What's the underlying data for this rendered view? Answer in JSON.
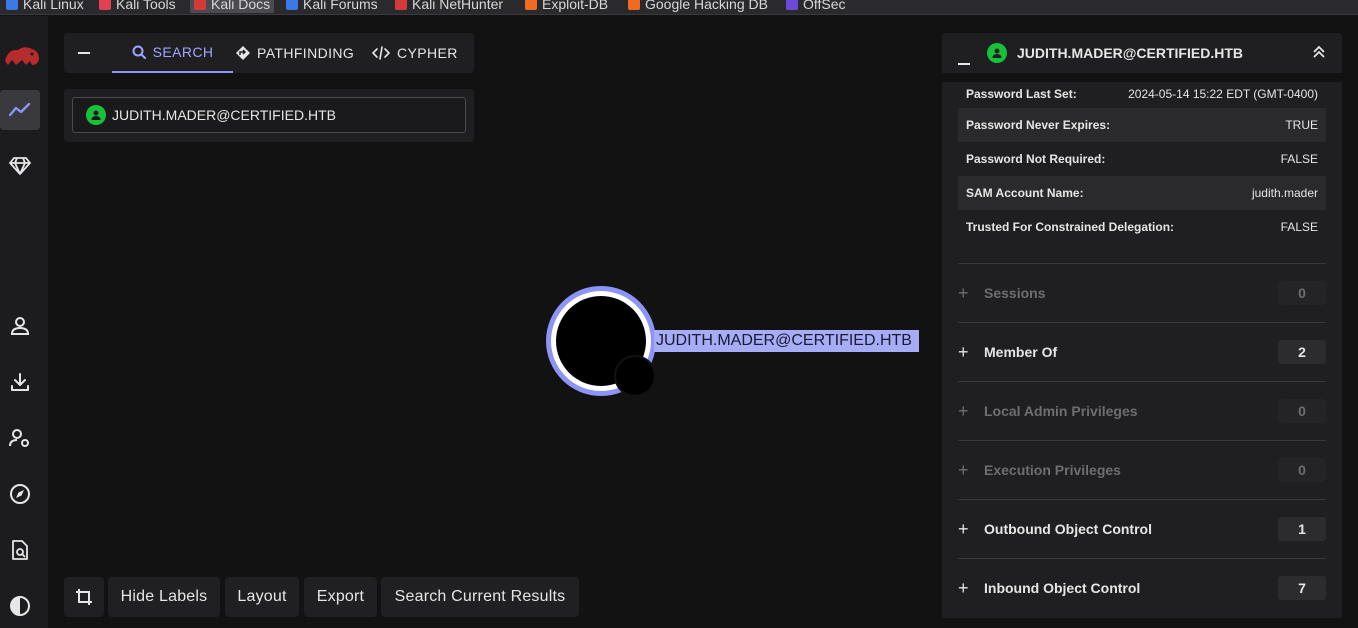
{
  "bookmarks": [
    {
      "label": "Kali Linux",
      "color": "#3b78e7"
    },
    {
      "label": "Kali Tools",
      "color": "#e0404f"
    },
    {
      "label": "Kali Docs",
      "color": "#d53a3a"
    },
    {
      "label": "Kali Forums",
      "color": "#3b78e7"
    },
    {
      "label": "Kali NetHunter",
      "color": "#d53a3a"
    },
    {
      "label": "Exploit-DB",
      "color": "#f06a22"
    },
    {
      "label": "Google Hacking DB",
      "color": "#f06a22"
    },
    {
      "label": "OffSec",
      "color": "#6a4bd8"
    }
  ],
  "search_panel": {
    "tabs": [
      {
        "label": "SEARCH",
        "icon": "search-icon"
      },
      {
        "label": "PATHFINDING",
        "icon": "diamond-arrow-icon"
      },
      {
        "label": "CYPHER",
        "icon": "code-icon"
      }
    ],
    "active_tab": "SEARCH",
    "search_value": "JUDITH.MADER@CERTIFIED.HTB"
  },
  "graph": {
    "node_label": "JUDITH.MADER@CERTIFIED.HTB",
    "accent": "#8c94f5"
  },
  "toolbar": {
    "hide_labels": "Hide Labels",
    "layout": "Layout",
    "export": "Export",
    "search_current": "Search Current Results"
  },
  "entity_panel": {
    "title": "JUDITH.MADER@CERTIFIED.HTB",
    "properties": [
      {
        "key": "Password Last Set:",
        "value": "2024-05-14 15:22 EDT (GMT-0400)"
      },
      {
        "key": "Password Never Expires:",
        "value": "TRUE"
      },
      {
        "key": "Password Not Required:",
        "value": "FALSE"
      },
      {
        "key": "SAM Account Name:",
        "value": "judith.mader"
      },
      {
        "key": "Trusted For Constrained Delegation:",
        "value": "FALSE"
      }
    ],
    "sections": [
      {
        "label": "Sessions",
        "count": "0",
        "enabled": false
      },
      {
        "label": "Member Of",
        "count": "2",
        "enabled": true
      },
      {
        "label": "Local Admin Privileges",
        "count": "0",
        "enabled": false
      },
      {
        "label": "Execution Privileges",
        "count": "0",
        "enabled": false
      },
      {
        "label": "Outbound Object Control",
        "count": "1",
        "enabled": true
      },
      {
        "label": "Inbound Object Control",
        "count": "7",
        "enabled": true
      }
    ]
  }
}
